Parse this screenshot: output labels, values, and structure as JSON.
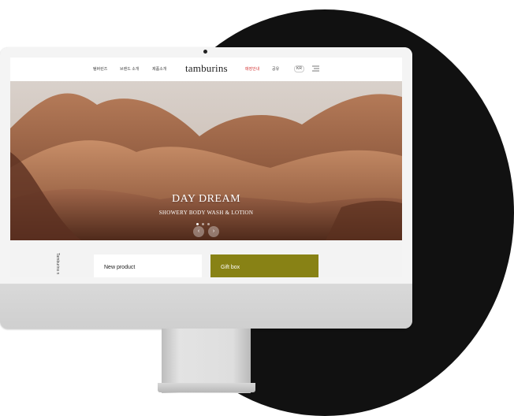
{
  "nav": {
    "items": [
      "탬버린즈",
      "브랜드 소개",
      "제품소개"
    ],
    "logo": "tamburins",
    "right_items": [
      "매장안내",
      "공유"
    ],
    "lang": "KR",
    "menu_icon": "hamburger-menu-icon"
  },
  "hero": {
    "title": "DAY DREAM",
    "subtitle": "SHOWERY BODY WASH & LOTION",
    "prev_icon": "chevron-left-icon",
    "next_icon": "chevron-right-icon",
    "prev_glyph": "‹",
    "next_glyph": "›",
    "slide_count": 3,
    "active_slide": 1
  },
  "bottom": {
    "vertical_label": "Tamburins n",
    "cards": [
      "New product",
      "Gift box"
    ]
  },
  "colors": {
    "background_circle": "#111111",
    "gift_card": "#888215",
    "active_nav": "#d43838"
  }
}
